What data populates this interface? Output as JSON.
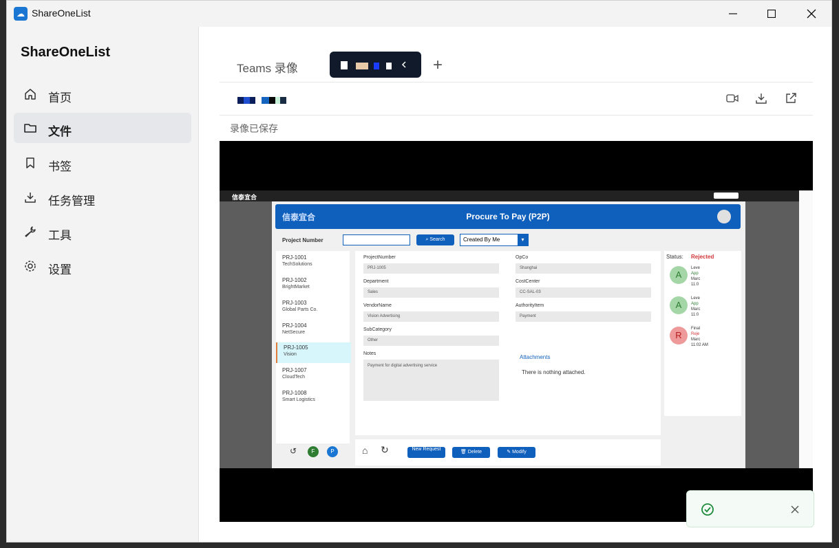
{
  "window": {
    "title": "ShareOneList"
  },
  "sidebar": {
    "title": "ShareOneList",
    "items": [
      {
        "label": "首页",
        "icon": "home-icon"
      },
      {
        "label": "文件",
        "icon": "folder-icon",
        "active": true
      },
      {
        "label": "书签",
        "icon": "bookmark-icon"
      },
      {
        "label": "任务管理",
        "icon": "download-icon"
      },
      {
        "label": "工具",
        "icon": "wrench-icon"
      },
      {
        "label": "设置",
        "icon": "gear-icon"
      }
    ]
  },
  "tabs": [
    {
      "label": "Teams 录像"
    }
  ],
  "status_text": "录像已保存",
  "recording": {
    "brand": "信泰宜合",
    "app_title": "Procure To Pay (P2P)",
    "project_label": "Project Number",
    "search_label": "Search",
    "created_by": "Created By Me",
    "projects": [
      {
        "id": "PRJ-1001",
        "name": "TechSolutions"
      },
      {
        "id": "PRJ-1002",
        "name": "BrightMarket"
      },
      {
        "id": "PRJ-1003",
        "name": "Global Parts Co."
      },
      {
        "id": "PRJ-1004",
        "name": "NetSecure"
      },
      {
        "id": "PRJ-1005",
        "name": "Vision"
      },
      {
        "id": "PRJ-1007",
        "name": "CloudTech"
      },
      {
        "id": "PRJ-1008",
        "name": "Smart Logistics"
      }
    ],
    "fields": {
      "project_number_label": "ProjectNumber",
      "project_number": "PRJ-1005",
      "opco_label": "OpCo",
      "opco": "Shanghai",
      "department_label": "Department",
      "department": "Sales",
      "costcenter_label": "CostCenter",
      "costcenter": "CC-SAL-03",
      "vendor_label": "VendorName",
      "vendor": "Vision Advertising",
      "authority_label": "AuthorityItem",
      "authority": "Payment",
      "subcategory_label": "SubCategory",
      "subcategory": "Other",
      "notes_label": "Notes",
      "notes": "Payment for digital advertising service",
      "attachments_label": "Attachments",
      "attachments": "There is nothing attached."
    },
    "status_label": "Status:",
    "status_value": "Rejected",
    "approvals": [
      {
        "letter": "A",
        "line1": "Leve",
        "line2": "App",
        "line3": "Marc",
        "line4": "11:0"
      },
      {
        "letter": "A",
        "line1": "Leve",
        "line2": "App",
        "line3": "Marc",
        "line4": "11:0"
      },
      {
        "letter": "R",
        "line1": "Final",
        "line2": "Reje",
        "line3": "Marc",
        "line4": "11:02 AM"
      }
    ],
    "buttons": {
      "new": "New Request",
      "delete": "Delete",
      "modify": "Modify"
    },
    "footer_avatars": [
      "F",
      "P"
    ]
  },
  "colors": {
    "accent": "#0f5fbd",
    "rejected": "#d13438",
    "selected_row": "#d7f6fb"
  }
}
